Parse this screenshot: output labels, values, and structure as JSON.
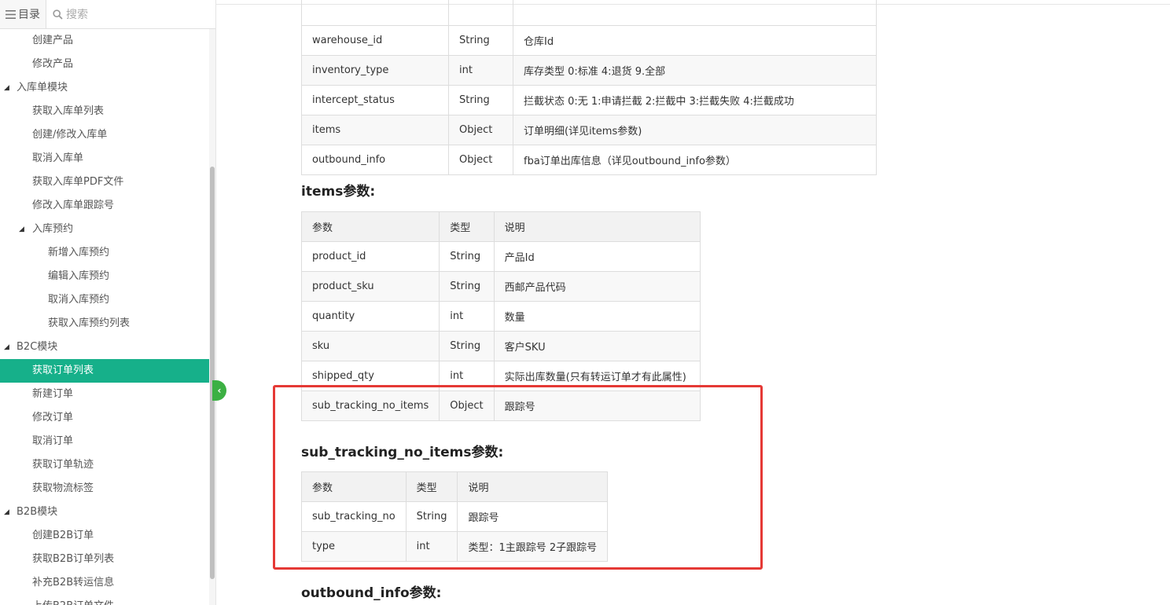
{
  "sidebar": {
    "catalog_label": "目录",
    "search_placeholder": "搜索",
    "items": [
      {
        "label": "创建产品"
      },
      {
        "label": "修改产品"
      },
      {
        "label": "入库单模块"
      },
      {
        "label": "获取入库单列表"
      },
      {
        "label": "创建/修改入库单"
      },
      {
        "label": "取消入库单"
      },
      {
        "label": "获取入库单PDF文件"
      },
      {
        "label": "修改入库单跟踪号"
      },
      {
        "label": "入库预约"
      },
      {
        "label": "新增入库预约"
      },
      {
        "label": "编辑入库预约"
      },
      {
        "label": "取消入库预约"
      },
      {
        "label": "获取入库预约列表"
      },
      {
        "label": "B2C模块"
      },
      {
        "label": "获取订单列表"
      },
      {
        "label": "新建订单"
      },
      {
        "label": "修改订单"
      },
      {
        "label": "取消订单"
      },
      {
        "label": "获取订单轨迹"
      },
      {
        "label": "获取物流标签"
      },
      {
        "label": "B2B模块"
      },
      {
        "label": "创建B2B订单"
      },
      {
        "label": "获取B2B订单列表"
      },
      {
        "label": "补充B2B转运信息"
      },
      {
        "label": "上传B2B订单文件"
      }
    ],
    "active_item": "获取订单列表",
    "colors": {
      "active_bg": "#16b08a",
      "collapse_btn": "#3cb043"
    }
  },
  "top_table": {
    "rows": [
      [
        "warehouse_id",
        "String",
        "仓库Id"
      ],
      [
        "inventory_type",
        "int",
        "库存类型 0:标准 4:退货 9.全部"
      ],
      [
        "intercept_status",
        "String",
        "拦截状态 0:无 1:申请拦截 2:拦截中 3:拦截失败 4:拦截成功"
      ],
      [
        "items",
        "Object",
        "订单明细(详见items参数)"
      ],
      [
        "outbound_info",
        "Object",
        "fba订单出库信息（详见outbound_info参数）"
      ]
    ]
  },
  "items_section": {
    "title": "items参数:",
    "headers": [
      "参数",
      "类型",
      "说明"
    ],
    "rows": [
      [
        "product_id",
        "String",
        "产品Id"
      ],
      [
        "product_sku",
        "String",
        "西邮产品代码"
      ],
      [
        "quantity",
        "int",
        "数量"
      ],
      [
        "sku",
        "String",
        "客户SKU"
      ],
      [
        "shipped_qty",
        "int",
        "实际出库数量(只有转运订单才有此属性)"
      ],
      [
        "sub_tracking_no_items",
        "Object",
        "跟踪号"
      ]
    ]
  },
  "sub_section": {
    "title": "sub_tracking_no_items参数:",
    "headers": [
      "参数",
      "类型",
      "说明"
    ],
    "rows": [
      [
        "sub_tracking_no",
        "String",
        "跟踪号"
      ],
      [
        "type",
        "int",
        "类型：1主跟踪号 2子跟踪号"
      ]
    ]
  },
  "outbound_section": {
    "title": "outbound_info参数:"
  },
  "highlight_color": "#e53935"
}
